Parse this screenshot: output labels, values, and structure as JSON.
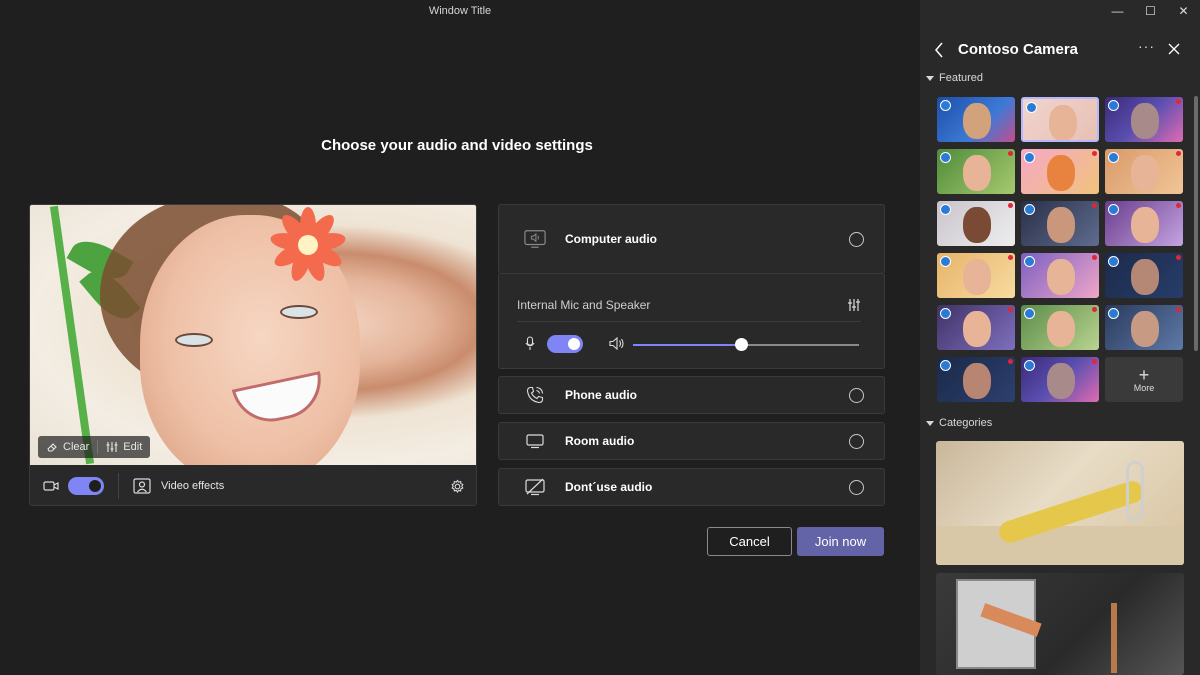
{
  "window": {
    "title": "Window Title",
    "controls": [
      "minimize",
      "maximize",
      "close"
    ]
  },
  "main": {
    "heading": "Choose your audio and video settings",
    "video": {
      "edit_chip": {
        "clear_label": "Clear",
        "edit_label": "Edit"
      },
      "camera_toggle": "on",
      "effects_label": "Video effects"
    },
    "audio": {
      "options": [
        {
          "label": "Computer audio",
          "icon": "monitor-speaker-icon",
          "selected": false
        },
        {
          "label": "Phone audio",
          "icon": "phone-icon",
          "selected": false
        },
        {
          "label": "Room audio",
          "icon": "room-display-icon",
          "selected": false
        },
        {
          "label": "Dont´use audio",
          "icon": "no-audio-icon",
          "selected": false
        }
      ],
      "device": "Internal Mic and Speaker",
      "mic_toggle": "on",
      "volume_level": 0.48
    },
    "buttons": {
      "cancel": "Cancel",
      "join": "Join now"
    }
  },
  "sidepanel": {
    "title": "Contoso Camera",
    "featured_label": "Featured",
    "more_label": "More",
    "categories_label": "Categories",
    "colors": {
      "accent": "#7f85f5",
      "join": "#6264a7",
      "badge": "#2a7bd6",
      "new_dot": "#e0263a"
    }
  }
}
